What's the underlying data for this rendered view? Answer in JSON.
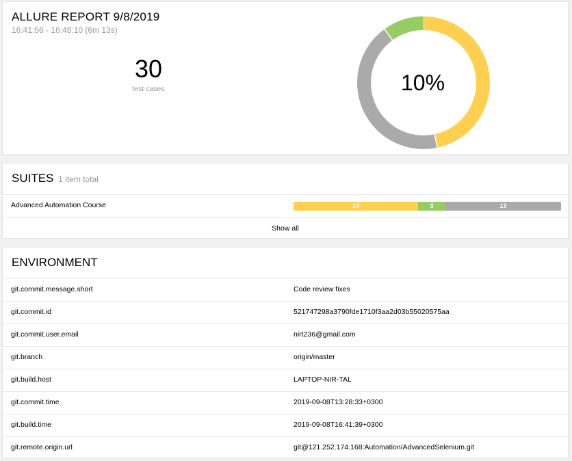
{
  "summary": {
    "title": "ALLURE REPORT 9/8/2019",
    "subtitle": "16:41:56 - 16:48:10 (6m 13s)",
    "test_count": "30",
    "test_count_label": "test cases",
    "success_percent": "10%",
    "donut": {
      "segments": [
        {
          "status": "broken",
          "value": 14,
          "color": "#ffd050"
        },
        {
          "status": "unknown",
          "value": 13,
          "color": "#aaaaaa"
        },
        {
          "status": "passed",
          "value": 3,
          "color": "#97cc64"
        }
      ]
    }
  },
  "suites": {
    "title": "SUITES",
    "subtitle": "1 item total",
    "items": [
      {
        "name": "Advanced Automation Course",
        "bar": [
          {
            "status": "broken",
            "value": 14,
            "label": "14",
            "color": "#ffd050"
          },
          {
            "status": "passed",
            "value": 3,
            "label": "3",
            "color": "#97cc64"
          },
          {
            "status": "unknown",
            "value": 13,
            "label": "13",
            "color": "#aaaaaa"
          }
        ]
      }
    ],
    "show_all": "Show all"
  },
  "environment": {
    "title": "ENVIRONMENT",
    "rows": [
      {
        "key": "git.commit.message.short",
        "value": "Code review fixes"
      },
      {
        "key": "git.commit.id",
        "value": "521747298a3790fde1710f3aa2d03b55020575aa"
      },
      {
        "key": "git.commit.user.email",
        "value": "nirt236@gmail.com"
      },
      {
        "key": "git.branch",
        "value": "origin/master"
      },
      {
        "key": "git.build.host",
        "value": "LAPTOP-NIR-TAL"
      },
      {
        "key": "git.commit.time",
        "value": "2019-09-08T13:28:33+0300"
      },
      {
        "key": "git.build.time",
        "value": "2019-09-08T16:41:39+0300"
      },
      {
        "key": "git.remote.origin.url",
        "value": "git@121.252.174.168:Automation/AdvancedSelenium.git"
      }
    ]
  }
}
